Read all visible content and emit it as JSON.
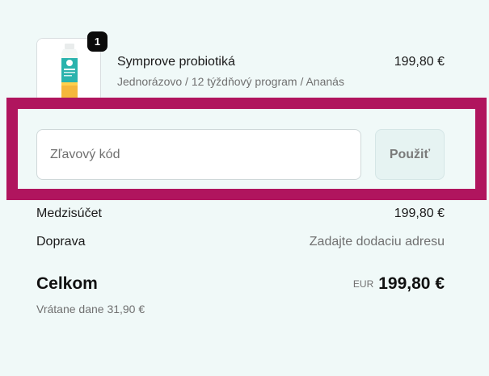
{
  "product": {
    "quantity": "1",
    "name": "Symprove probiotiká",
    "variant": "Jednorázovo / 12 týždňový program / Ananás",
    "price": "199,80 €",
    "image_icon": "probiotic-bottle-icon"
  },
  "discount": {
    "placeholder": "Zľavový kód",
    "value": "",
    "apply_label": "Použiť"
  },
  "summary": {
    "subtotal_label": "Medzisúčet",
    "subtotal_value": "199,80 €",
    "shipping_label": "Doprava",
    "shipping_value": "Zadajte dodaciu adresu"
  },
  "total": {
    "label": "Celkom",
    "currency": "EUR",
    "amount": "199,80 €",
    "tax_note": "Vrátane dane 31,90 €"
  },
  "colors": {
    "background": "#f0f9f8",
    "highlight": "#b0155e",
    "badge": "#0b0b0b"
  }
}
